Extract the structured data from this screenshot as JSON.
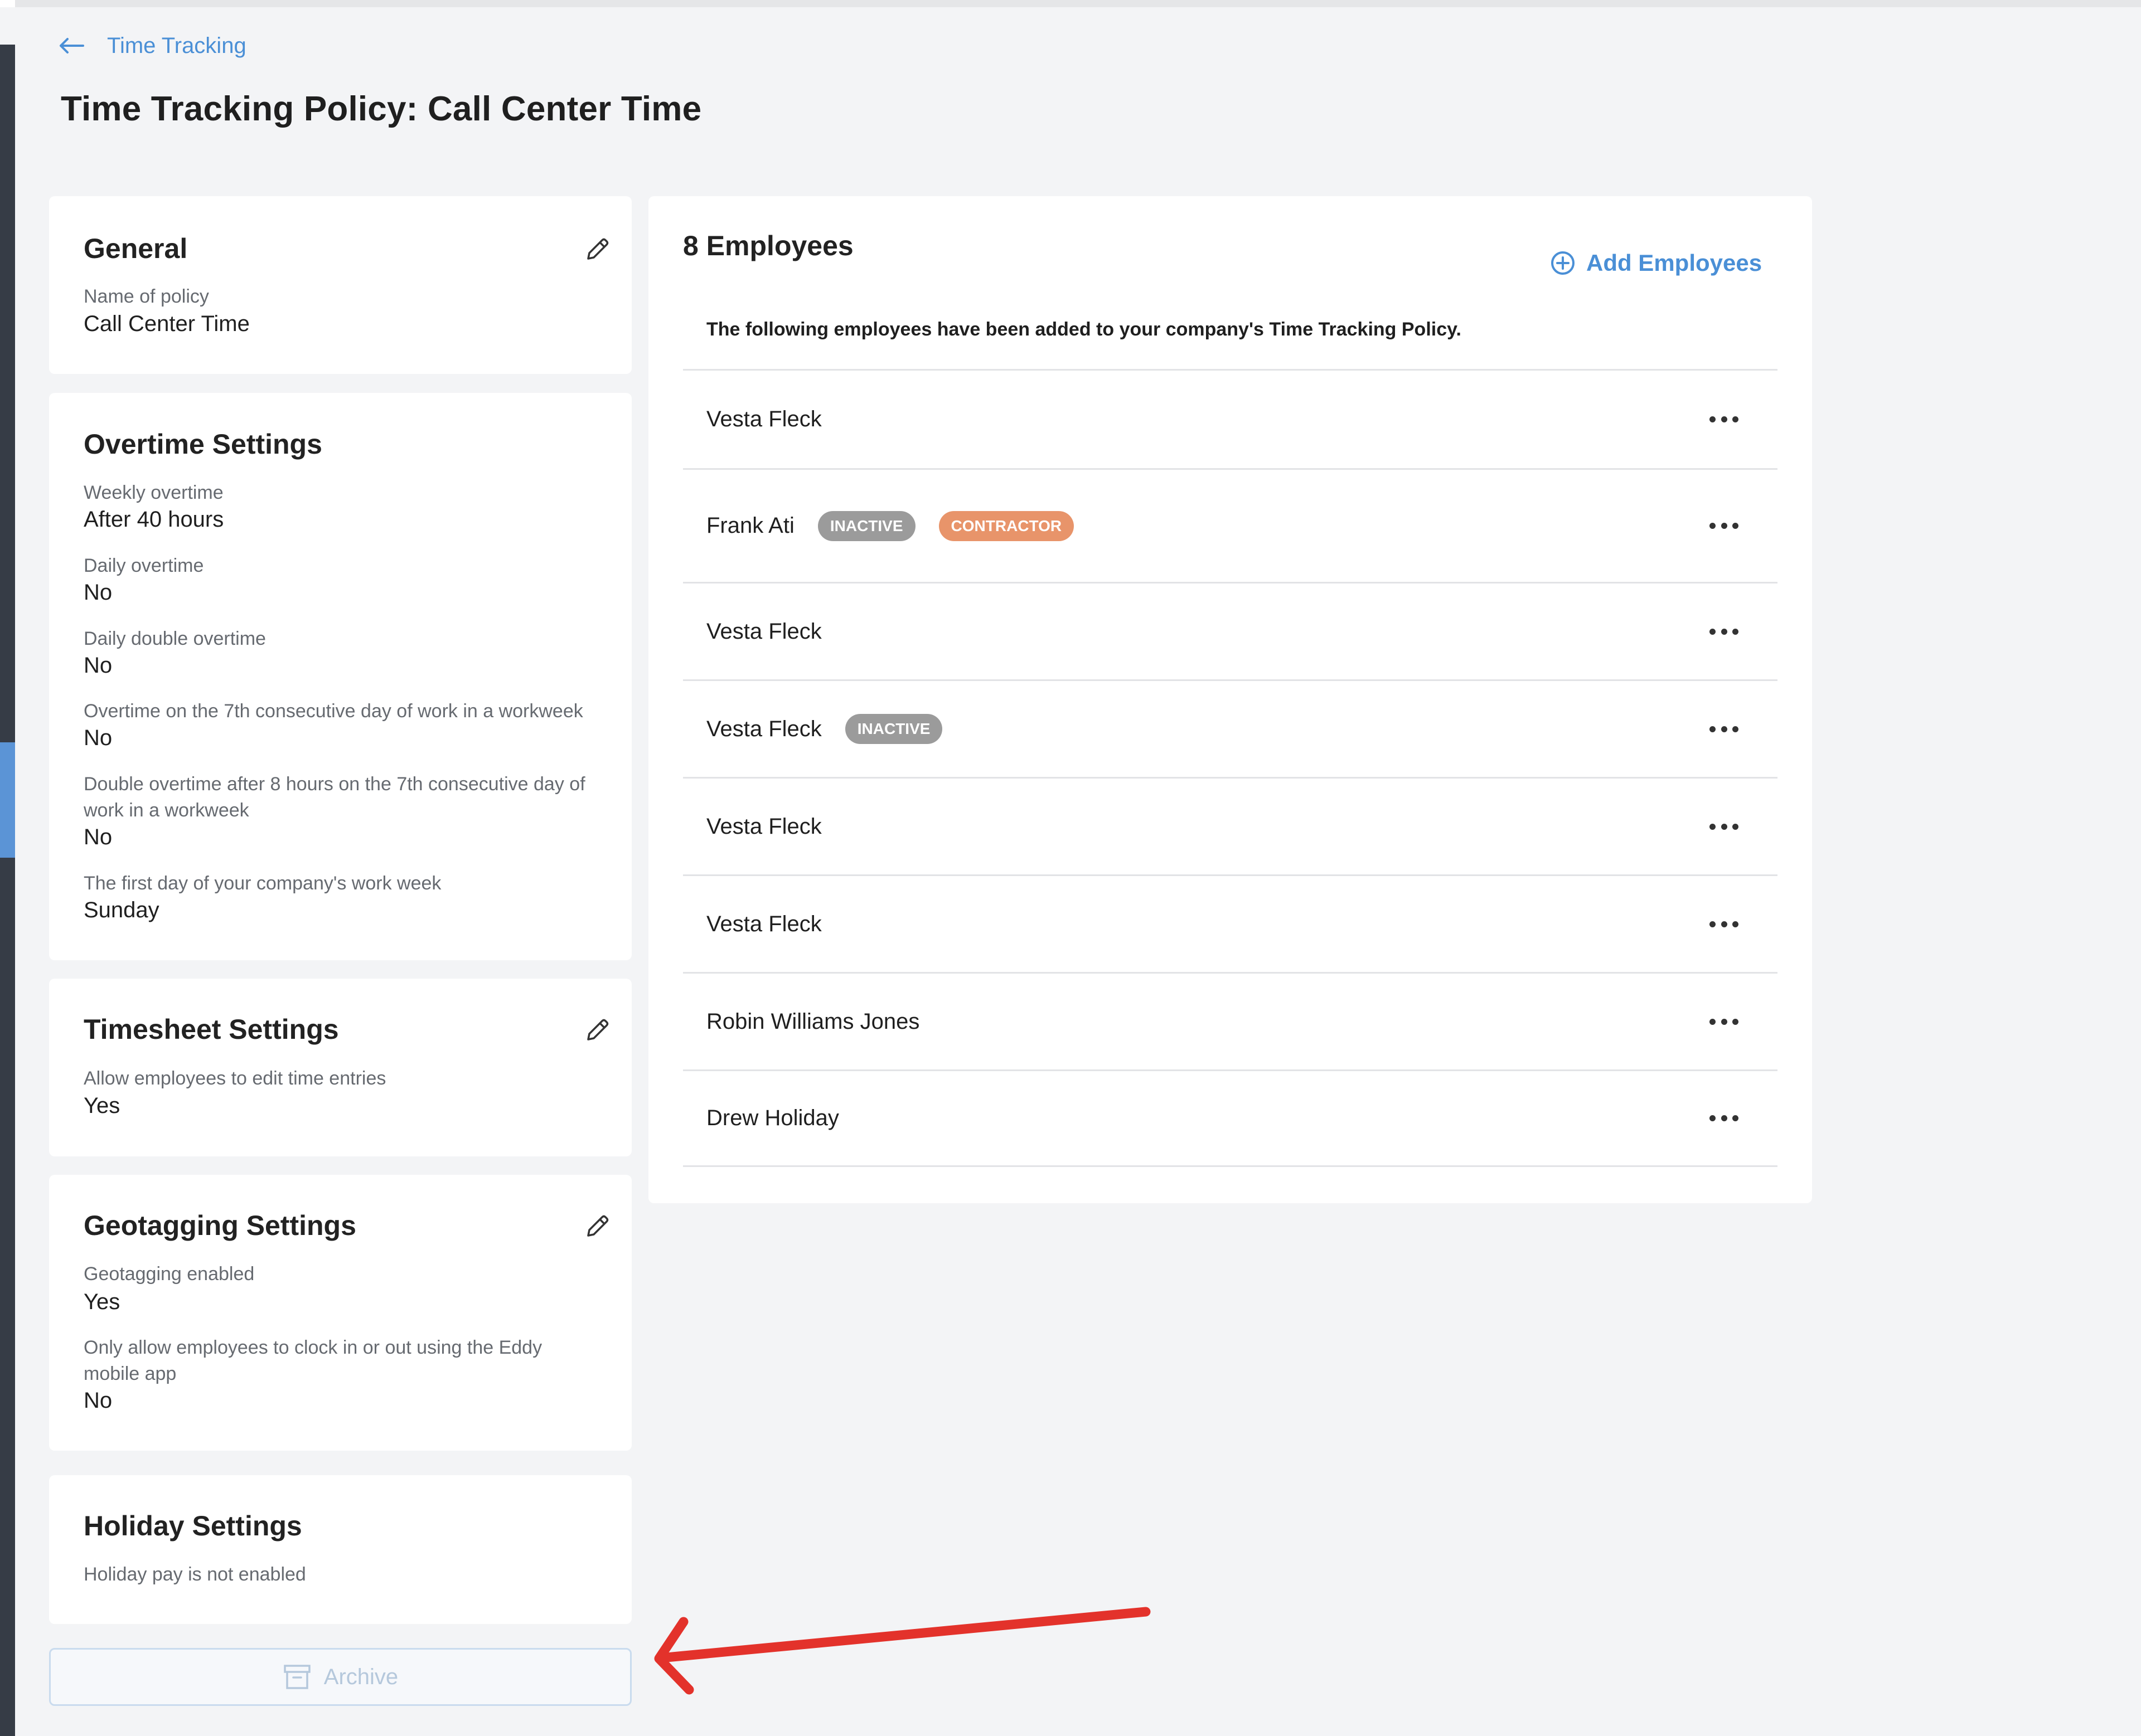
{
  "back_link": {
    "label": "Time Tracking",
    "icon": "arrow-left-icon"
  },
  "page_title": "Time Tracking Policy: Call Center Time",
  "general": {
    "title": "General",
    "fields": [
      {
        "label": "Name of policy",
        "value": "Call Center Time"
      }
    ]
  },
  "overtime": {
    "title": "Overtime Settings",
    "fields": [
      {
        "label": "Weekly overtime",
        "value": "After 40 hours"
      },
      {
        "label": "Daily overtime",
        "value": "No"
      },
      {
        "label": "Daily double overtime",
        "value": "No"
      },
      {
        "label": "Overtime on the 7th consecutive day of work in a workweek",
        "value": "No"
      },
      {
        "label_line1": "Double overtime after 8 hours on the 7th consecutive day of",
        "label_line2": "work in a workweek",
        "value": "No"
      },
      {
        "label": "The first day of your company's work week",
        "value": "Sunday"
      }
    ]
  },
  "timesheet": {
    "title": "Timesheet Settings",
    "fields": [
      {
        "label": "Allow employees to edit time entries",
        "value": "Yes"
      }
    ]
  },
  "geotagging": {
    "title": "Geotagging Settings",
    "fields": [
      {
        "label": "Geotagging enabled",
        "value": "Yes"
      },
      {
        "label_line1": "Only allow employees to clock in or out using the Eddy",
        "label_line2": "mobile app",
        "value": "No"
      }
    ]
  },
  "holiday": {
    "title": "Holiday Settings",
    "note": "Holiday pay is not enabled"
  },
  "archive_button": {
    "label": "Archive",
    "icon": "archive-box-icon"
  },
  "employees": {
    "title": "8 Employees",
    "add_label": "Add Employees",
    "description": "The following employees have been added to your company's Time Tracking Policy.",
    "list": [
      {
        "name": "Vesta Fleck"
      },
      {
        "name": "Frank Ati",
        "badges": [
          "INACTIVE",
          "CONTRACTOR"
        ]
      },
      {
        "name": "Vesta Fleck"
      },
      {
        "name": "Vesta Fleck",
        "badges": [
          "INACTIVE"
        ]
      },
      {
        "name": "Vesta Fleck"
      },
      {
        "name": "Vesta Fleck"
      },
      {
        "name": "Robin Williams Jones"
      },
      {
        "name": "Drew Holiday"
      }
    ]
  },
  "colors": {
    "accent": "#4a8fd6",
    "inactive_badge": "#9b9b9b",
    "contractor_badge": "#e8946a",
    "annotation_arrow": "#e3322b"
  }
}
